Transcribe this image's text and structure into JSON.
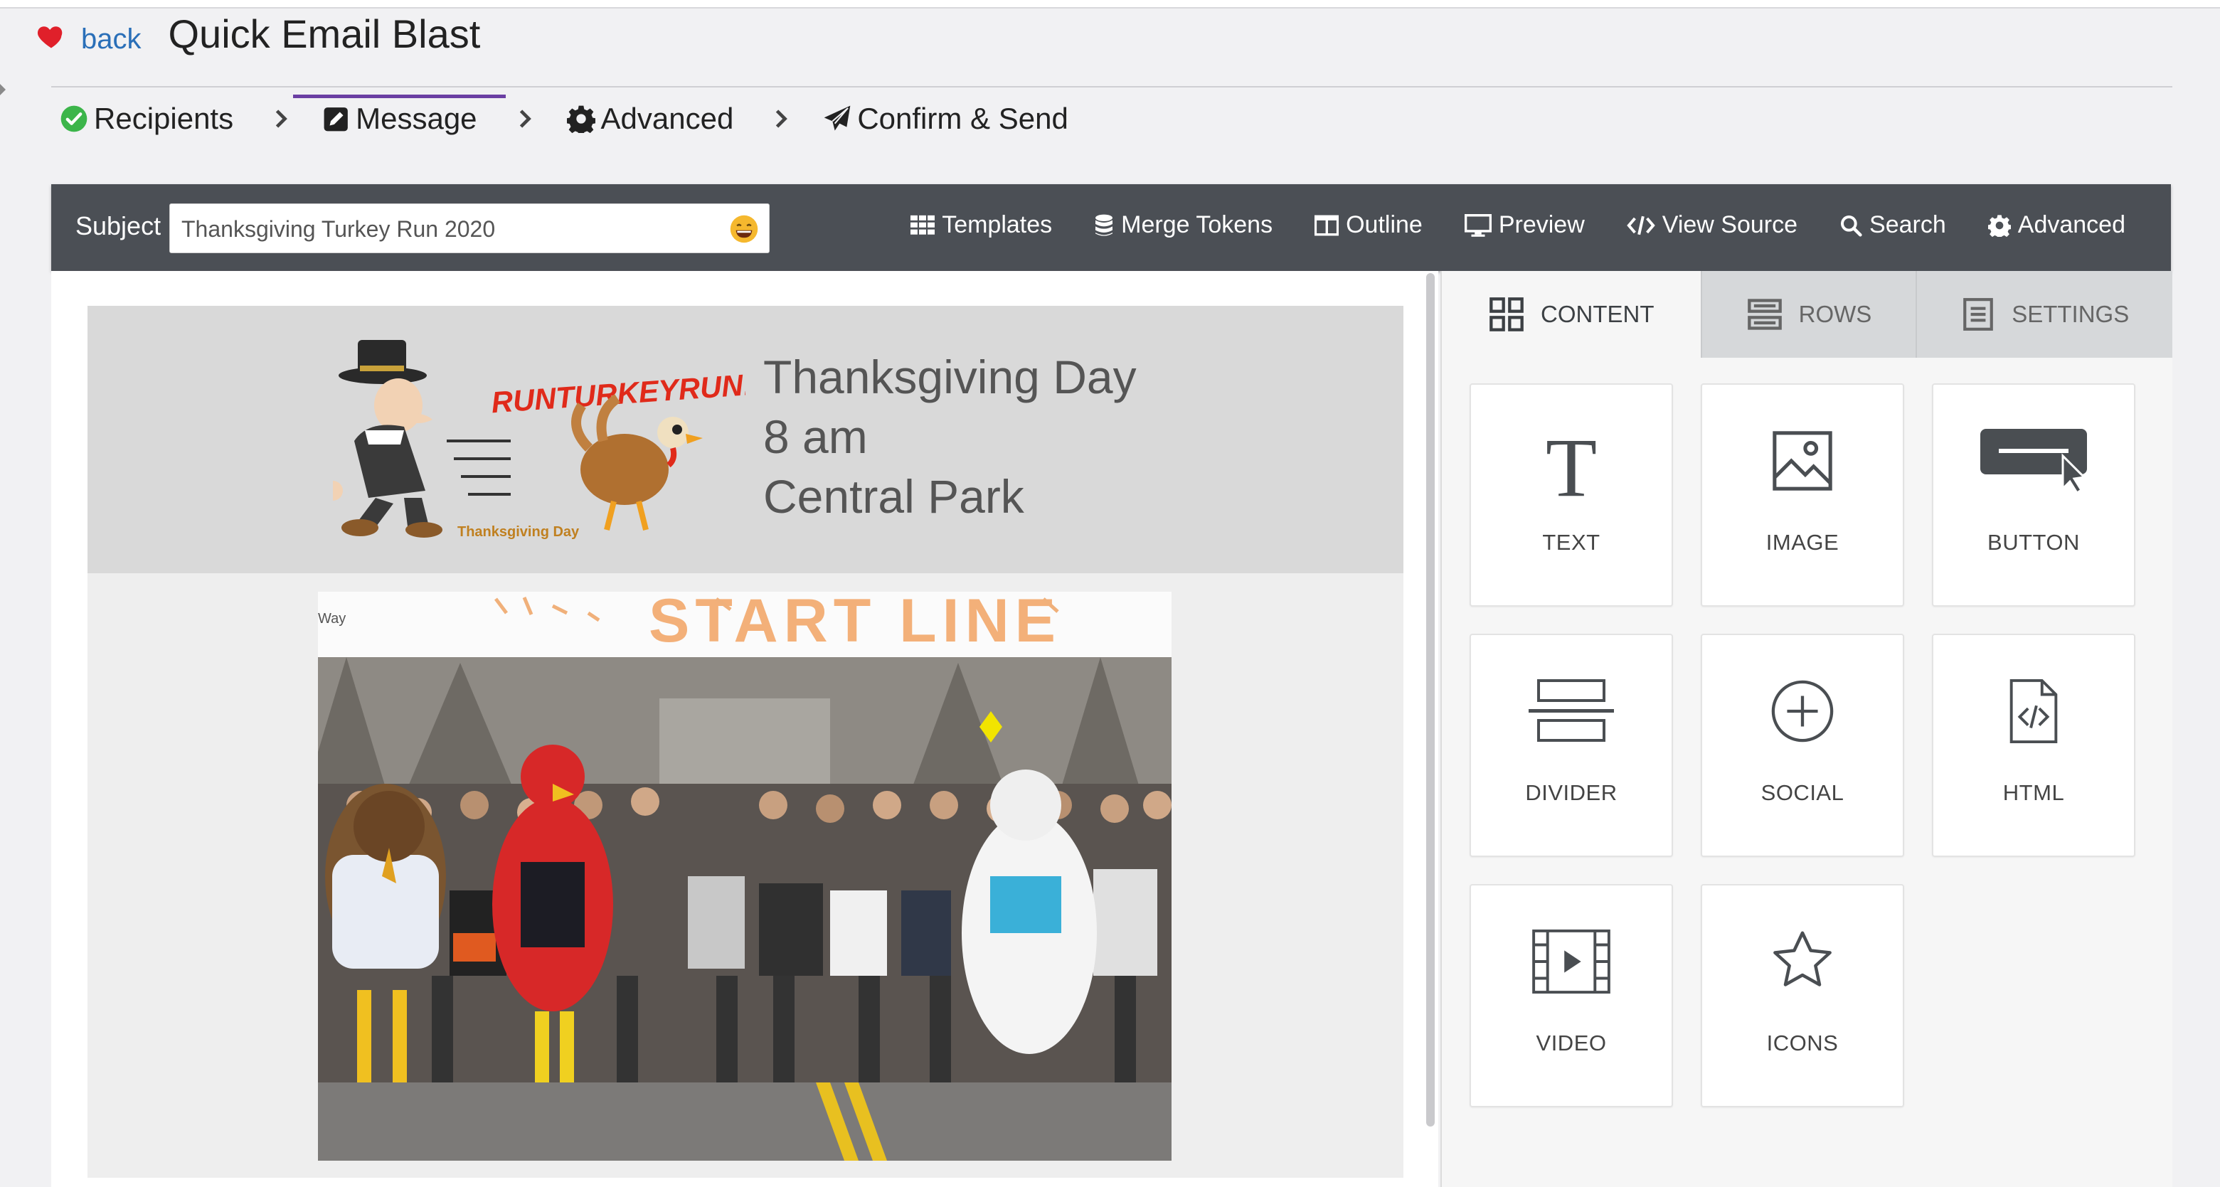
{
  "header": {
    "back_label": "back",
    "title": "Quick Email Blast"
  },
  "steps": [
    {
      "label": "Recipients",
      "icon": "check-circle-icon",
      "state": "complete"
    },
    {
      "label": "Message",
      "icon": "edit-icon",
      "state": "active"
    },
    {
      "label": "Advanced",
      "icon": "gear-icon",
      "state": "pending"
    },
    {
      "label": "Confirm & Send",
      "icon": "paper-plane-icon",
      "state": "pending"
    }
  ],
  "toolbar": {
    "subject_label": "Subject",
    "subject_value": "Thanksgiving Turkey Run 2020",
    "tools": [
      {
        "label": "Templates",
        "icon": "grid-icon"
      },
      {
        "label": "Merge Tokens",
        "icon": "database-icon"
      },
      {
        "label": "Outline",
        "icon": "outline-icon"
      },
      {
        "label": "Preview",
        "icon": "monitor-icon"
      },
      {
        "label": "View Source",
        "icon": "code-icon"
      },
      {
        "label": "Search",
        "icon": "search-icon"
      },
      {
        "label": "Advanced",
        "icon": "gear-icon"
      }
    ]
  },
  "email": {
    "logo_text": "RUNTURKEYRUN!",
    "logo_subtext": "Thanksgiving Day",
    "event_lines": [
      "Thanksgiving Day",
      "8 am",
      "Central Park"
    ],
    "photo_banner": "START LINE",
    "photo_sign": "Way"
  },
  "panel": {
    "tabs": [
      {
        "label": "CONTENT",
        "icon": "grid-icon",
        "active": true
      },
      {
        "label": "ROWS",
        "icon": "rows-icon",
        "active": false
      },
      {
        "label": "SETTINGS",
        "icon": "settings-icon",
        "active": false
      }
    ],
    "blocks": [
      {
        "label": "TEXT",
        "icon": "text-icon"
      },
      {
        "label": "IMAGE",
        "icon": "image-icon"
      },
      {
        "label": "BUTTON",
        "icon": "button-icon"
      },
      {
        "label": "DIVIDER",
        "icon": "divider-icon"
      },
      {
        "label": "SOCIAL",
        "icon": "social-icon"
      },
      {
        "label": "HTML",
        "icon": "html-icon"
      },
      {
        "label": "VIDEO",
        "icon": "video-icon"
      },
      {
        "label": "ICONS",
        "icon": "star-icon"
      }
    ]
  },
  "colors": {
    "toolbar_bg": "#4b4f55",
    "active_step": "#6b3fa3",
    "link": "#2a6fb8",
    "check": "#3cb54a",
    "heart": "#e0202a"
  }
}
